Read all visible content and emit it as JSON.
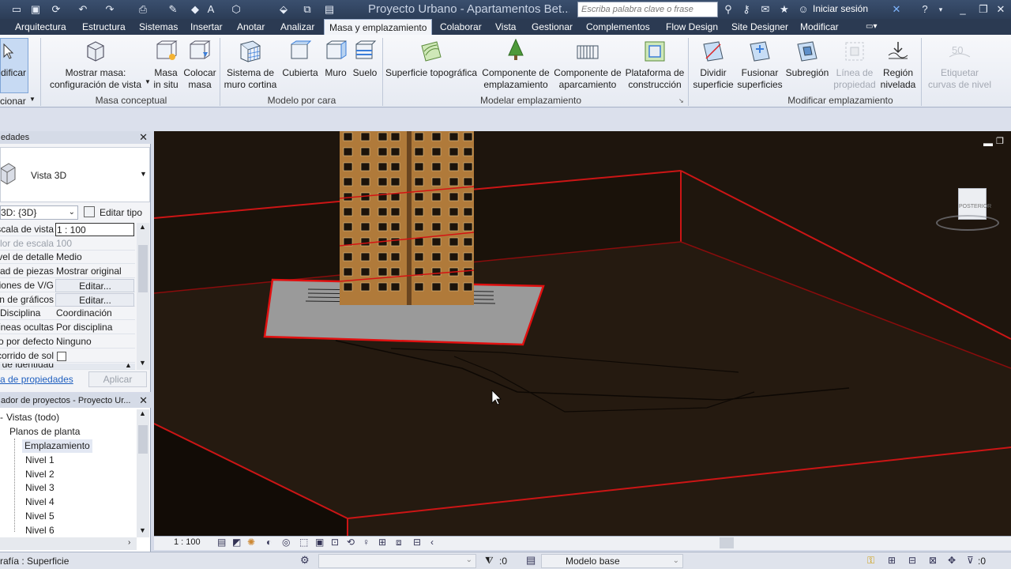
{
  "window": {
    "title": "Proyecto Urbano - Apartamentos Bet...",
    "search_placeholder": "Escriba palabra clave o frase",
    "login_label": "Iniciar sesión"
  },
  "tabs": [
    "Arquitectura",
    "Estructura",
    "Sistemas",
    "Insertar",
    "Anotar",
    "Analizar",
    "Masa y emplazamiento",
    "Colaborar",
    "Vista",
    "Gestionar",
    "Complementos",
    "Flow Design",
    "Site Designer",
    "Modificar"
  ],
  "active_tab": "Masa y emplazamiento",
  "ribbon": {
    "modify_label": "dificar",
    "select_label": "cionar",
    "masa_conceptual": {
      "panel": "Masa conceptual",
      "show_mass": [
        "Mostrar masa:",
        "configuración de vista"
      ],
      "in_place": [
        "Masa",
        "in situ"
      ],
      "place_mass": [
        "Colocar",
        "masa"
      ]
    },
    "modelo_por_cara": {
      "panel": "Modelo por cara",
      "curtain": [
        "Sistema de",
        "muro cortina"
      ],
      "roof": "Cubierta",
      "wall": "Muro",
      "floor": "Suelo"
    },
    "modelar_emplazamiento": {
      "panel": "Modelar emplazamiento",
      "toposurface": "Superficie topográfica",
      "site_component": [
        "Componente de",
        "emplazamiento"
      ],
      "parking": [
        "Componente de",
        "aparcamiento"
      ],
      "pad": [
        "Plataforma de",
        "construcción"
      ]
    },
    "modificar_emplazamiento": {
      "panel": "Modificar emplazamiento",
      "split": [
        "Dividir",
        "superficie"
      ],
      "merge": [
        "Fusionar",
        "superficies"
      ],
      "subregion": "Subregión",
      "property_line": [
        "Línea de",
        "propiedad"
      ],
      "graded": [
        "Región",
        "nivelada"
      ],
      "label_contours": [
        "Etiquetar",
        "curvas de nivel"
      ]
    }
  },
  "properties": {
    "header": "edades",
    "type_name": "Vista 3D",
    "instance_select": "3D: {3D}",
    "edit_type": "Editar tipo",
    "rows": [
      {
        "key": "Escala de vista",
        "value": "1 : 100"
      },
      {
        "key": "Valor de escala",
        "value": "100"
      },
      {
        "key": "Nivel de detalle",
        "value": "Medio"
      },
      {
        "key": "Visibilidad de piezas",
        "value": "Mostrar original"
      },
      {
        "key": "Modificaciones de V/G",
        "value": "Editar..."
      },
      {
        "key": "Opciones de visualización de gráficos",
        "value": "Editar..."
      },
      {
        "key": "Disciplina",
        "value": "Coordinación"
      },
      {
        "key": "Mostrar líneas ocultas",
        "value": "Por disciplina"
      },
      {
        "key": "Estilo por defecto",
        "value": "Ninguno"
      },
      {
        "key": "Recorrido de sol",
        "value": ""
      },
      {
        "key": "Datos de identidad",
        "value": ""
      }
    ],
    "help_link": "a de propiedades",
    "apply": "Aplicar"
  },
  "browser": {
    "header": "ador de proyectos - Proyecto Ur...",
    "items": [
      {
        "label": "Vistas (todo)",
        "level": 0
      },
      {
        "label": "Planos de planta",
        "level": 1
      },
      {
        "label": "Emplazamiento",
        "level": 2
      },
      {
        "label": "Nivel 1",
        "level": 2
      },
      {
        "label": "Nivel 2",
        "level": 2
      },
      {
        "label": "Nivel 3",
        "level": 2
      },
      {
        "label": "Nivel 4",
        "level": 2
      },
      {
        "label": "Nivel 5",
        "level": 2
      },
      {
        "label": "Nivel 6",
        "level": 2
      }
    ]
  },
  "viewcube_label": "POSTERIOR",
  "view_scale": "1 : 100",
  "status": {
    "left": "rafía : Superficie",
    "zero_a": ":0",
    "model": "Modelo base",
    "zero_b": ":0"
  },
  "colors": {
    "ground": "#1e150d",
    "edge_highlight": "#e01010",
    "pad": "#9a9a9a",
    "tower": "#b07a3a"
  }
}
